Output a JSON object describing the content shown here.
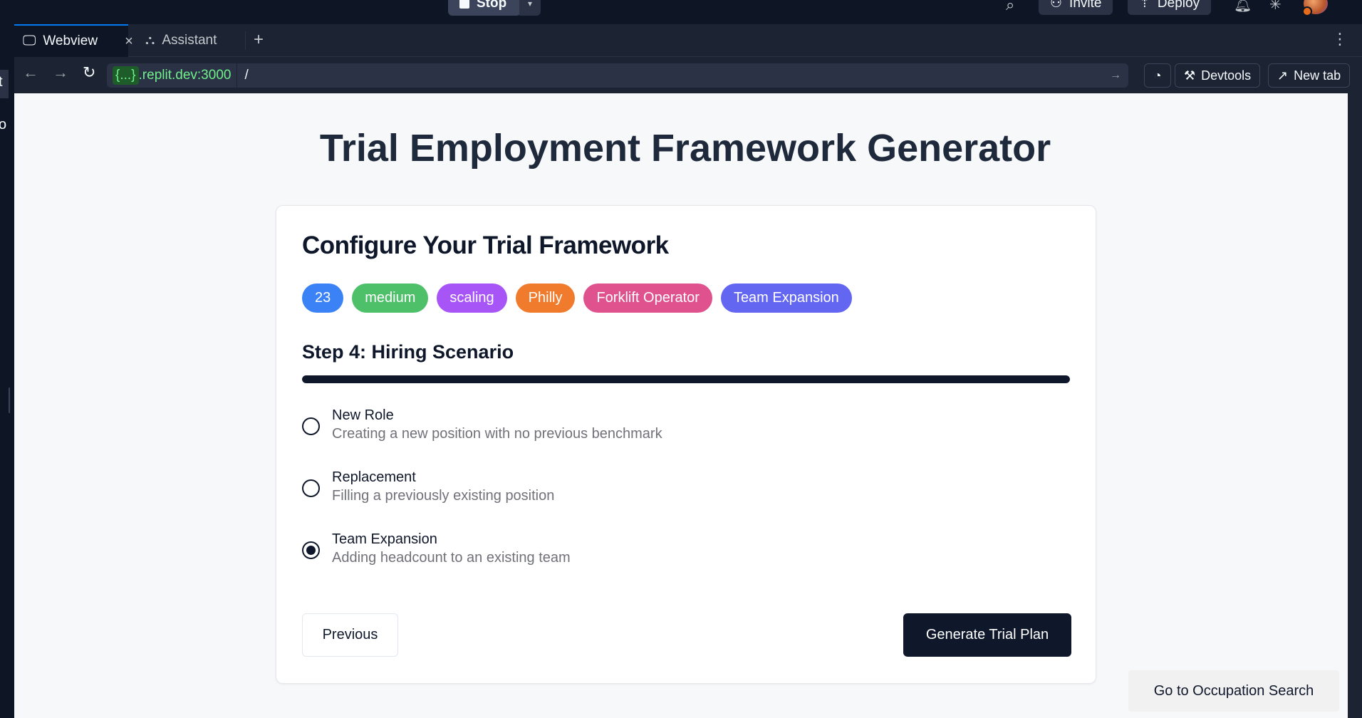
{
  "topbar": {
    "stop_label": "Stop",
    "invite_label": "Invite",
    "deploy_label": "Deploy"
  },
  "leftstrip": {
    "char1": "t",
    "char2": "o"
  },
  "tabs": [
    {
      "label": "Webview",
      "icon": "monitor-icon"
    },
    {
      "label": "Assistant",
      "icon": "assistant-icon"
    }
  ],
  "addressbar": {
    "url_prefix": "{...}",
    "url_host": ".replit.dev:3000",
    "url_path": "/",
    "devtools_label": "Devtools",
    "newtab_label": "New tab"
  },
  "page": {
    "title": "Trial Employment Framework Generator",
    "card_title": "Configure Your Trial Framework",
    "badges": [
      {
        "label": "23",
        "color": "#3b82f6"
      },
      {
        "label": "medium",
        "color": "#4ec06a"
      },
      {
        "label": "scaling",
        "color": "#a855f7"
      },
      {
        "label": "Philly",
        "color": "#f07b2c"
      },
      {
        "label": "Forklift Operator",
        "color": "#e0528e"
      },
      {
        "label": "Team Expansion",
        "color": "#6366f1"
      }
    ],
    "step_title": "Step 4: Hiring Scenario",
    "progress_percent": 100,
    "options": [
      {
        "label": "New Role",
        "description": "Creating a new position with no previous benchmark",
        "checked": false
      },
      {
        "label": "Replacement",
        "description": "Filling a previously existing position",
        "checked": false
      },
      {
        "label": "Team Expansion",
        "description": "Adding headcount to an existing team",
        "checked": true
      }
    ],
    "previous_label": "Previous",
    "generate_label": "Generate Trial Plan",
    "occupation_label": "Go to Occupation Search"
  }
}
